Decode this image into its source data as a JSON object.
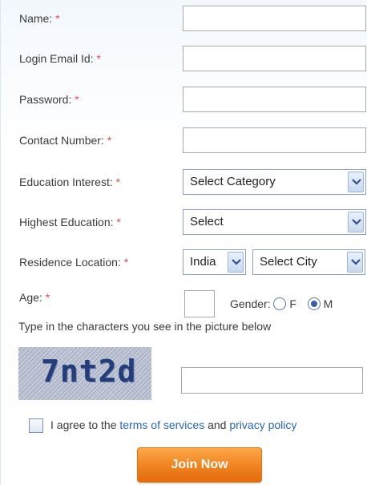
{
  "form": {
    "name_label": "Name:",
    "email_label": "Login Email Id:",
    "password_label": "Password:",
    "contact_label": "Contact Number:",
    "education_interest_label": "Education Interest:",
    "education_interest_value": "Select Category",
    "highest_education_label": "Highest Education:",
    "highest_education_value": "Select",
    "residence_label": "Residence Location:",
    "country_value": "India",
    "city_value": "Select City",
    "age_label": "Age:",
    "gender_label": "Gender:",
    "gender_f": "F",
    "gender_m": "M",
    "gender_selected": "M",
    "required_mark": "*",
    "captcha_instruction": "Type in the characters you see in the picture below",
    "captcha_image_text": "7nt2d",
    "agree_prefix": "I agree to the",
    "terms_link": "terms of services",
    "agree_and": "and",
    "privacy_link": "privacy policy",
    "join_button": "Join Now"
  },
  "colors": {
    "required": "#e0495a",
    "link": "#2a66b3",
    "button": "#f1821f"
  }
}
